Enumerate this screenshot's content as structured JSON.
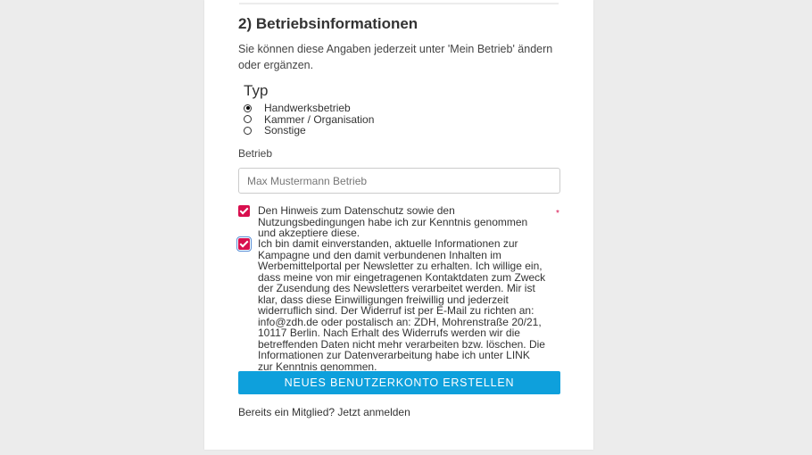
{
  "section": {
    "title": "2) Betriebsinformationen",
    "hint": "Sie können diese Angaben jederzeit unter 'Mein Betrieb' ändern oder ergänzen."
  },
  "type_group": {
    "label": "Typ",
    "options": [
      {
        "label": "Handwerksbetrieb",
        "checked": true
      },
      {
        "label": "Kammer / Organisation",
        "checked": false
      },
      {
        "label": "Sonstige",
        "checked": false
      }
    ]
  },
  "business_field": {
    "label": "Betrieb",
    "placeholder": "Max Mustermann Betrieb",
    "value": ""
  },
  "consents": {
    "privacy": {
      "text": "Den Hinweis zum Datenschutz sowie den Nutzungsbedingungen habe ich zur Kenntnis genommen und akzeptiere diese.",
      "checked": true,
      "required_marker": "*"
    },
    "newsletter": {
      "text": "Ich bin damit einverstanden, aktuelle Informationen zur Kampagne und den damit verbundenen Inhalten im Werbemittelportal per Newsletter zu erhalten. Ich willige ein, dass meine von mir eingetragenen Kontaktdaten zum Zweck der Zusendung des Newsletters verarbeitet werden. Mir ist klar, dass diese Einwilligungen freiwillig und jederzeit widerruflich sind. Der Widerruf ist per E-Mail zu richten an: info@zdh.de oder postalisch an: ZDH, Mohrenstraße 20/21, 10117 Berlin. Nach Erhalt des Widerrufs werden wir die betreffenden Daten nicht mehr verarbeiten bzw. löschen. Die Informationen zur Datenverarbeitung habe ich unter LINK zur Kenntnis genommen.",
      "checked": true
    }
  },
  "submit_label": "NEUES BENUTZERKONTO ERSTELLEN",
  "login_prompt": "Bereits ein Mitglied? Jetzt anmelden",
  "colors": {
    "accent_checkbox": "#d80f4e",
    "primary_button": "#0ea0dc",
    "page_background": "#ececec"
  }
}
